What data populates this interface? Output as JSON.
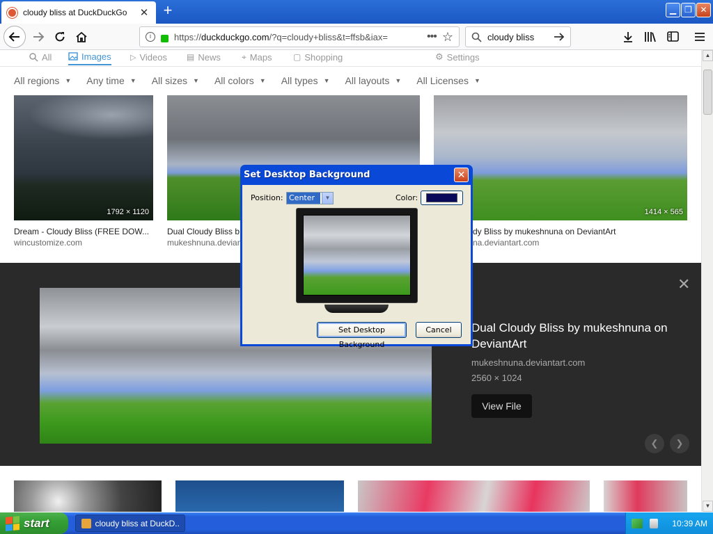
{
  "browser": {
    "tab_title": "cloudy bliss at DuckDuckGo",
    "new_tab": "+",
    "url_prefix": "https://",
    "url_host": "duckduckgo.com",
    "url_rest": "/?q=cloudy+bliss&t=ffsb&iax=",
    "search_query": "cloudy bliss"
  },
  "ddg": {
    "nav": [
      "All",
      "Images",
      "Videos",
      "News",
      "Maps",
      "Shopping",
      "Settings"
    ],
    "filters": [
      "All regions",
      "Any time",
      "All sizes",
      "All colors",
      "All types",
      "All layouts",
      "All Licenses"
    ],
    "results": [
      {
        "dims": "1792 × 1120",
        "title": "Dream - Cloudy Bliss (FREE DOW...",
        "domain": "wincustomize.com"
      },
      {
        "dims": "",
        "title": "Dual Cloudy Bliss b",
        "domain": "mukeshnuna.devian"
      },
      {
        "dims": "1414 × 565",
        "title": "dy Bliss by mukeshnuna on DeviantArt",
        "domain": "na.deviantart.com"
      }
    ],
    "detail": {
      "title": "Dual Cloudy Bliss by mukeshnuna on DeviantArt",
      "domain": "mukeshnuna.deviantart.com",
      "dims": "2560 × 1024",
      "view_file": "View File"
    }
  },
  "dialog": {
    "title": "Set Desktop Background",
    "position_label": "Position:",
    "position_value": "Center",
    "color_label": "Color:",
    "color_value": "#0a0a5a",
    "set_button": "Set Desktop Background",
    "cancel_button": "Cancel"
  },
  "taskbar": {
    "start": "start",
    "task": "cloudy bliss at DuckD...",
    "clock": "10:39 AM"
  }
}
